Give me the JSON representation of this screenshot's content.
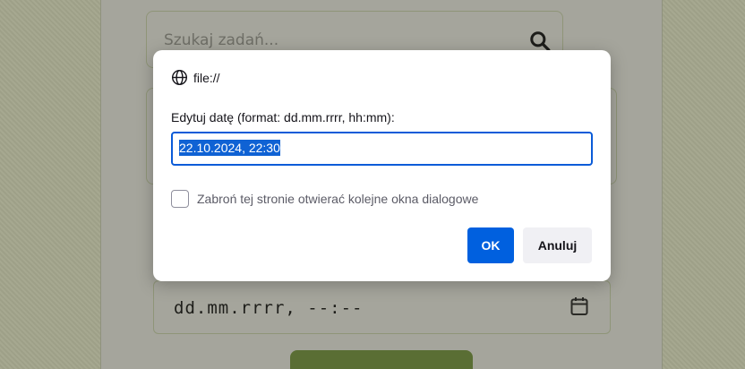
{
  "background": {
    "search": {
      "placeholder": "Szukaj zadań..."
    },
    "date_field": {
      "placeholder": "dd.mm.rrrr, --:--"
    }
  },
  "dialog": {
    "origin": "file://",
    "message": "Edytuj datę (format: dd.mm.rrrr, hh:mm):",
    "input_value": "22.10.2024, 22:30",
    "checkbox_label": "Zabroń tej stronie otwierać kolejne okna dialogowe",
    "checkbox_checked": false,
    "ok_label": "OK",
    "cancel_label": "Anuluj"
  },
  "colors": {
    "accent": "#0060df",
    "selection": "#0f62d4",
    "submit_button": "#5a6e34"
  }
}
